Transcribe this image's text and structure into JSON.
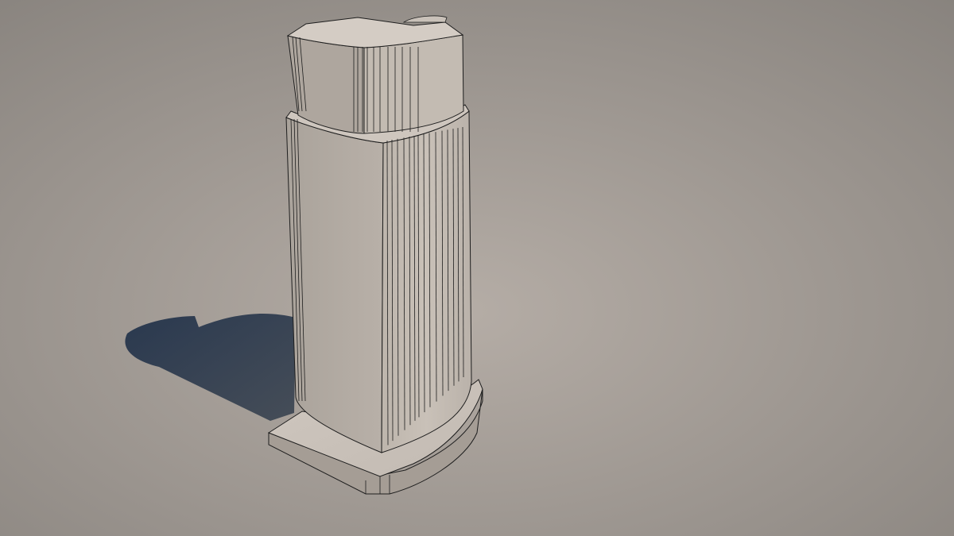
{
  "scene": {
    "subject": "tower-model-wireframe-render",
    "background": {
      "center": "#b3aba5",
      "edge": "#8b8680"
    },
    "colors": {
      "tower_face_light": "#c8c0b8",
      "tower_face_mid": "#b9b1a9",
      "tower_face_dark": "#a39b93",
      "edge_line": "#1e1e1e",
      "shadow": "#233449"
    }
  }
}
